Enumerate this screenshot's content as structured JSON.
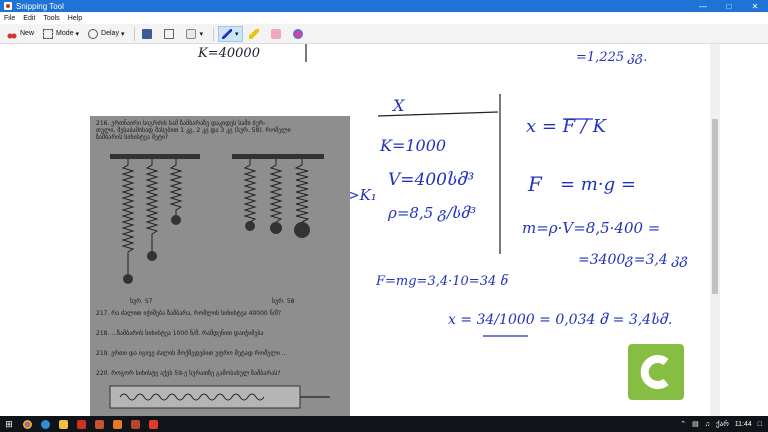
{
  "window": {
    "title": "Snipping Tool"
  },
  "menu": {
    "items": [
      "File",
      "Edit",
      "Tools",
      "Help"
    ]
  },
  "toolbar": {
    "new_label": "New",
    "mode_label": "Mode",
    "delay_label": "Delay"
  },
  "notes": {
    "top_left": "K=40000",
    "top_right": "=1,225 კგ.",
    "given_x": "X",
    "given_k": "K=1000",
    "given_v": "V=400სმ³",
    "given_rho": "ρ=8,5 გ/სმ³",
    "formula_x": "x = F / K",
    "f_label": "F",
    "formula_f": "= m·g =",
    "mass_line": "m=ρ·V=8,5·400 =",
    "mass_result": "=3400გ=3,4 კგ",
    "compare": "K₃>K₂>K₁",
    "force_line": "F=mg=3,4·10=34 ნ",
    "x_result": "x = 34/1000 = 0,034 მ = 3,4სმ."
  },
  "book": {
    "problem_216": "216. ერთნაირი სიგრძის სამ ზამბარაზე დაკიდეს სამი ბურ-",
    "problem_216b": "თული, შესაბამისად მასებით 1 კგ, 2 კგ და 3 კგ (სურ. 58). რომელი",
    "problem_216c": "ზამბარის სიხისტეა მეტი?",
    "fig57": "სურ. 57",
    "fig58": "სურ. 58",
    "problem_217": "217. რა ძალით იჭიმება ზამბარა, რომლის სიხისტეა 40000 ნ/მ?",
    "problem_218": "218. ...ზამბარის სიხისტეა 1000 ნ/მ. რამდენით დაიჭიმება",
    "problem_219": "219. ერთი და იგივე ძალის მოქმედებით უფრო მეტად რომელი ...",
    "problem_220": "220. როგორ სიხისტე აქვს 59-ე სურათზე გამოსახულ ზამბარას?"
  },
  "tray": {
    "lang": "ქარ",
    "time": "11:44"
  }
}
